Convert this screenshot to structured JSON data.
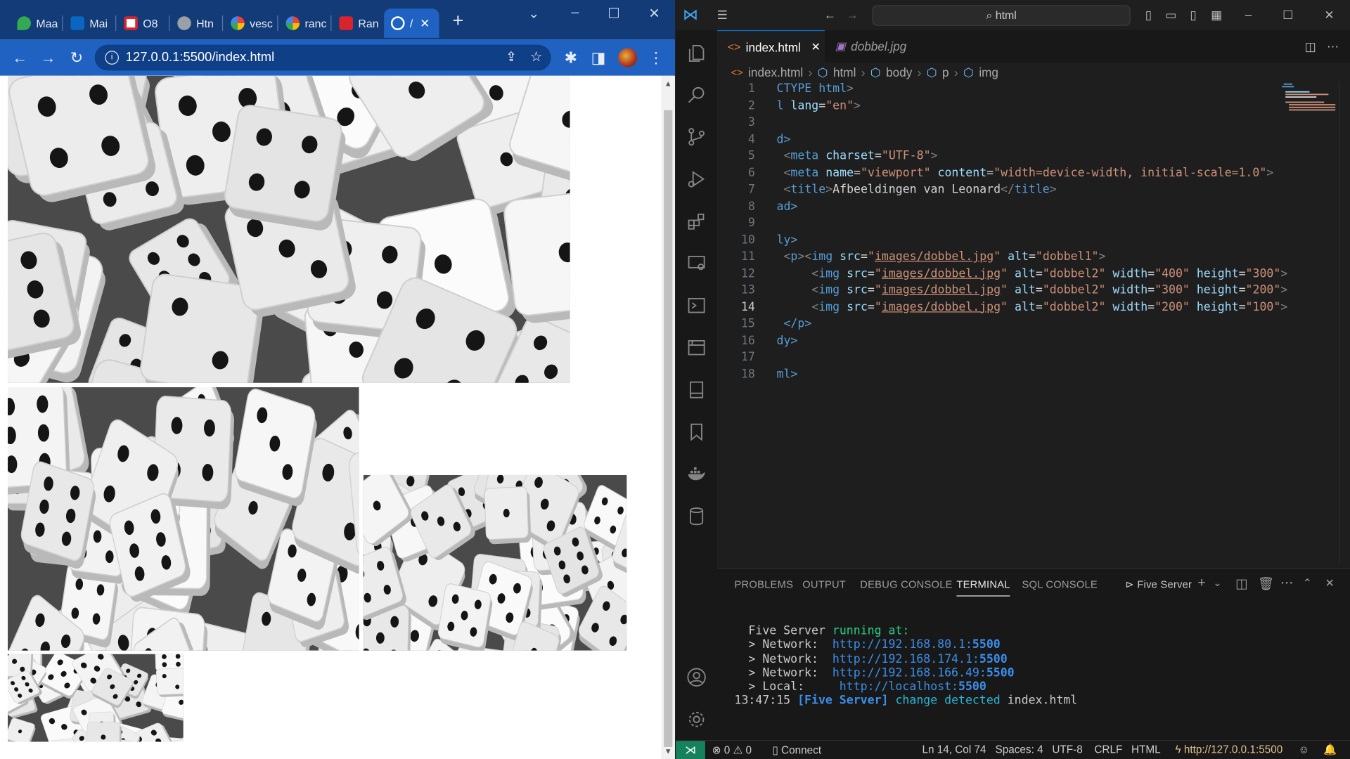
{
  "browser": {
    "tabs": [
      {
        "label": "Maa",
        "color": "#34a853"
      },
      {
        "label": "Mai",
        "color": "#0a66c2"
      },
      {
        "label": "O8",
        "color": "#d9232d"
      },
      {
        "label": "Htn",
        "color": "#9aa0a6"
      },
      {
        "label": "vesc",
        "color": "#4285f4"
      },
      {
        "label": "ranc",
        "color": "#4285f4"
      },
      {
        "label": "Ran",
        "color": "#d9232d"
      },
      {
        "label": "/",
        "color": "#bdbdbd"
      }
    ],
    "url": "127.0.0.1:5500/index.html",
    "images": [
      {
        "alt": "dobbel1"
      },
      {
        "alt": "dobbel2",
        "width": "400",
        "height": "300"
      },
      {
        "alt": "dobbel2",
        "width": "300",
        "height": "200"
      },
      {
        "alt": "dobbel2",
        "width": "200",
        "height": "100"
      }
    ]
  },
  "vscode": {
    "search": "html",
    "tabs": {
      "active": "index.html",
      "inactive": "dobbel.jpg"
    },
    "breadcrumb": [
      "index.html",
      "html",
      "body",
      "p",
      "img"
    ],
    "line_numbers": [
      "1",
      "2",
      "3",
      "4",
      "5",
      "6",
      "7",
      "8",
      "9",
      "10",
      "11",
      "12",
      "13",
      "14",
      "15",
      "16",
      "17",
      "18"
    ],
    "code": {
      "l1a": "CTYPE",
      "l1b": "html",
      "l1c": ">",
      "l2a": "l",
      "l2b": "lang",
      "l2c": "\"en\"",
      "l2d": ">",
      "l4": "d>",
      "l5a": "<",
      "l5b": "meta",
      "l5c": "charset",
      "l5d": "\"UTF-8\"",
      "l5e": ">",
      "l6a": "<",
      "l6b": "meta",
      "l6c": "name",
      "l6d": "\"viewport\"",
      "l6e": "content",
      "l6f": "\"width=device-width, initial-scale=1.0\"",
      "l6g": ">",
      "l7a": "<",
      "l7b": "title",
      "l7c": ">",
      "l7d": "Afbeeldingen van Leonard",
      "l7e": "</",
      "l7f": "title",
      "l7g": ">",
      "l8": "ad>",
      "l10": "ly>",
      "img_src": "images/dobbel.jpg",
      "l11alt": "\"dobbel1\"",
      "alt2": "\"dobbel2\"",
      "w12": "\"400\"",
      "h12": "\"300\"",
      "w13": "\"300\"",
      "h13": "\"200\"",
      "w14": "\"200\"",
      "h14": "\"100\"",
      "l15": "</p>",
      "l16": "dy>",
      "l18": "ml>"
    },
    "panel": {
      "tabs": [
        "PROBLEMS",
        "OUTPUT",
        "DEBUG CONSOLE",
        "TERMINAL",
        "SQL CONSOLE"
      ],
      "active_tab": "TERMINAL",
      "server_label": "Five Server"
    },
    "terminal": {
      "line1a": "Five Server ",
      "line1b": "running at:",
      "net_label": "> Network:",
      "local_label": "> Local:   ",
      "urls": [
        {
          "host": "http://192.168.80.1:",
          "port": "5500"
        },
        {
          "host": "http://192.168.174.1:",
          "port": "5500"
        },
        {
          "host": "http://192.168.166.49:",
          "port": "5500"
        },
        {
          "host": "http://localhost:",
          "port": "5500"
        }
      ],
      "time": "13:47:15",
      "tag": "[Five Server]",
      "msg": "change detected",
      "file": "index.html"
    },
    "status": {
      "errors": "0",
      "warnings": "0",
      "connect": "Connect",
      "position": "Ln 14, Col 74",
      "spaces": "Spaces: 4",
      "encoding": "UTF-8",
      "eol": "CRLF",
      "lang": "HTML",
      "server": "http://127.0.0.1:5500"
    }
  }
}
